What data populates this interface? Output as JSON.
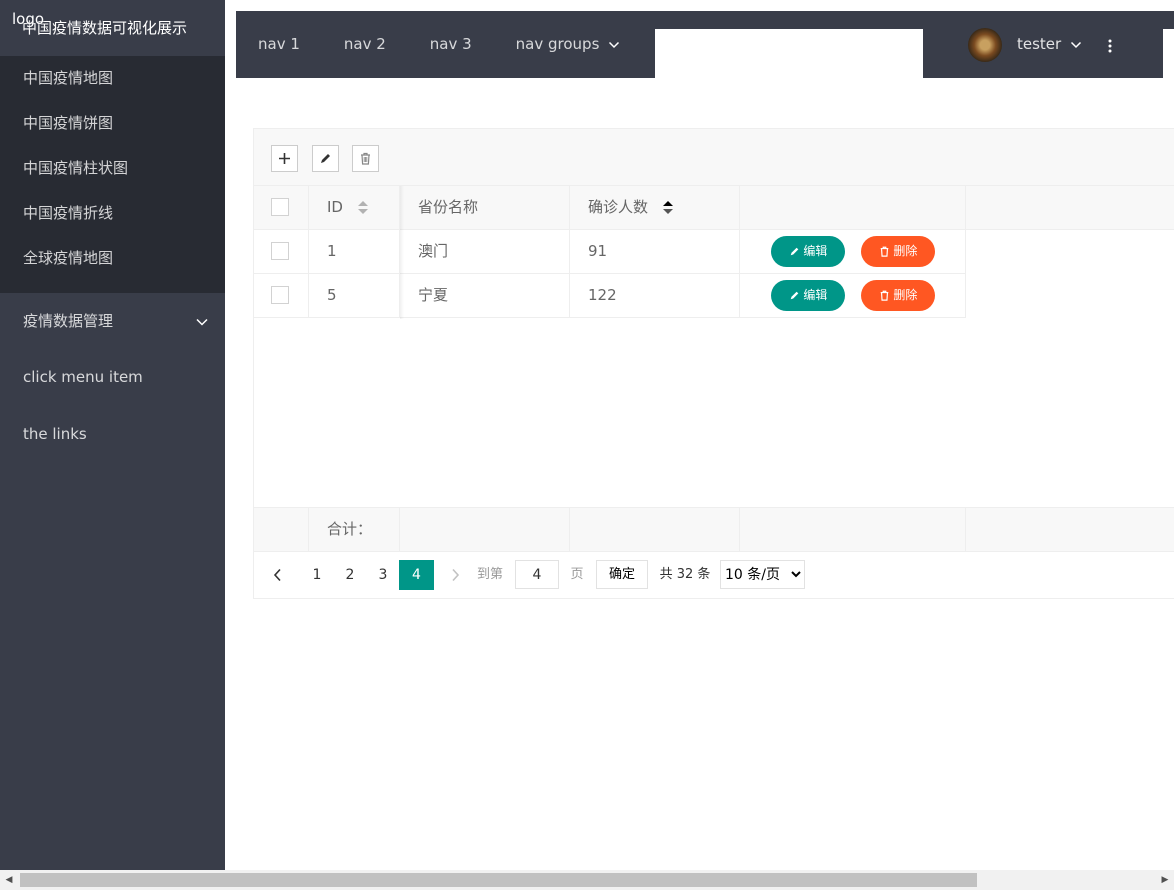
{
  "logo": "logo",
  "app_title": "中国疫情数据可视化展示",
  "sidebar": {
    "sub_items": [
      {
        "label": "中国疫情地图"
      },
      {
        "label": "中国疫情饼图"
      },
      {
        "label": "中国疫情柱状图"
      },
      {
        "label": "中国疫情折线"
      },
      {
        "label": "全球疫情地图"
      }
    ],
    "items": [
      {
        "label": "疫情数据管理"
      },
      {
        "label": "click menu item"
      },
      {
        "label": "the links"
      }
    ]
  },
  "header": {
    "nav": [
      {
        "label": "nav 1"
      },
      {
        "label": "nav 2"
      },
      {
        "label": "nav 3"
      },
      {
        "label": "nav groups"
      }
    ],
    "user": "tester"
  },
  "table": {
    "columns": [
      "ID",
      "省份名称",
      "确诊人数"
    ],
    "rows": [
      {
        "id": "1",
        "province": "澳门",
        "confirmed": "91"
      },
      {
        "id": "5",
        "province": "宁夏",
        "confirmed": "122"
      }
    ],
    "edit_label": "编辑",
    "delete_label": "删除",
    "total_label": "合计："
  },
  "pager": {
    "pages": [
      "1",
      "2",
      "3",
      "4"
    ],
    "current": "4",
    "goto_label": "到第",
    "goto_value": "4",
    "page_unit": "页",
    "confirm_label": "确定",
    "total_text": "共 32 条",
    "page_size": "10 条/页"
  },
  "colors": {
    "sidebar_bg": "#393d49",
    "submenu_bg": "#282b33",
    "primary": "#009688",
    "danger": "#ff5722"
  }
}
